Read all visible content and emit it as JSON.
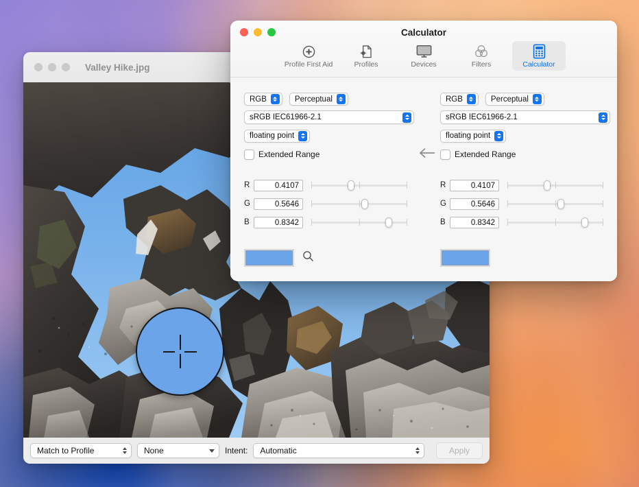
{
  "desktop": {
    "wallpaper_colors": [
      "#8f7fd4",
      "#f3b184",
      "#0a46be",
      "#f59646"
    ]
  },
  "image_window": {
    "title": "Valley Hike.jpg",
    "traffic_lights": [
      "close",
      "minimize",
      "zoom"
    ],
    "loupe": {
      "icon": "crosshair-loupe",
      "fill_color": "#6ba4e8"
    },
    "bottom_bar": {
      "match_popup": "Match to Profile",
      "profile_popup": "None",
      "intent_label": "Intent:",
      "intent_popup": "Automatic",
      "apply_button": "Apply",
      "apply_enabled": false
    }
  },
  "calculator_window": {
    "title": "Calculator",
    "traffic_lights": [
      "close",
      "minimize",
      "zoom"
    ],
    "toolbar": {
      "items": [
        {
          "label": "Profile First Aid",
          "icon": "plus-circle-icon",
          "selected": false
        },
        {
          "label": "Profiles",
          "icon": "document-gear-icon",
          "selected": false
        },
        {
          "label": "Devices",
          "icon": "display-icon",
          "selected": false
        },
        {
          "label": "Filters",
          "icon": "venn-circles-icon",
          "selected": false
        },
        {
          "label": "Calculator",
          "icon": "calculator-icon",
          "selected": true
        }
      ],
      "accent_color": "#0a72ea"
    },
    "transfer_arrow": {
      "icon": "arrow-left-icon",
      "direction": "left"
    },
    "left_panel": {
      "color_space": "RGB",
      "intent": "Perceptual",
      "profile": "sRGB IEC61966-2.1",
      "encoding": "floating point",
      "extended_range_label": "Extended Range",
      "extended_range_checked": false,
      "channels": [
        {
          "name": "R",
          "value": "0.4107",
          "fraction": 0.4107
        },
        {
          "name": "G",
          "value": "0.5646",
          "fraction": 0.5646
        },
        {
          "name": "B",
          "value": "0.8342",
          "fraction": 0.8342
        }
      ],
      "swatch_color": "#6ba4e8",
      "picker_icon": "magnifier-icon"
    },
    "right_panel": {
      "color_space": "RGB",
      "intent": "Perceptual",
      "profile": "sRGB IEC61966-2.1",
      "encoding": "floating point",
      "extended_range_label": "Extended Range",
      "extended_range_checked": false,
      "channels": [
        {
          "name": "R",
          "value": "0.4107",
          "fraction": 0.4107
        },
        {
          "name": "G",
          "value": "0.5646",
          "fraction": 0.5646
        },
        {
          "name": "B",
          "value": "0.8342",
          "fraction": 0.8342
        }
      ],
      "swatch_color": "#6ba4e8"
    }
  }
}
